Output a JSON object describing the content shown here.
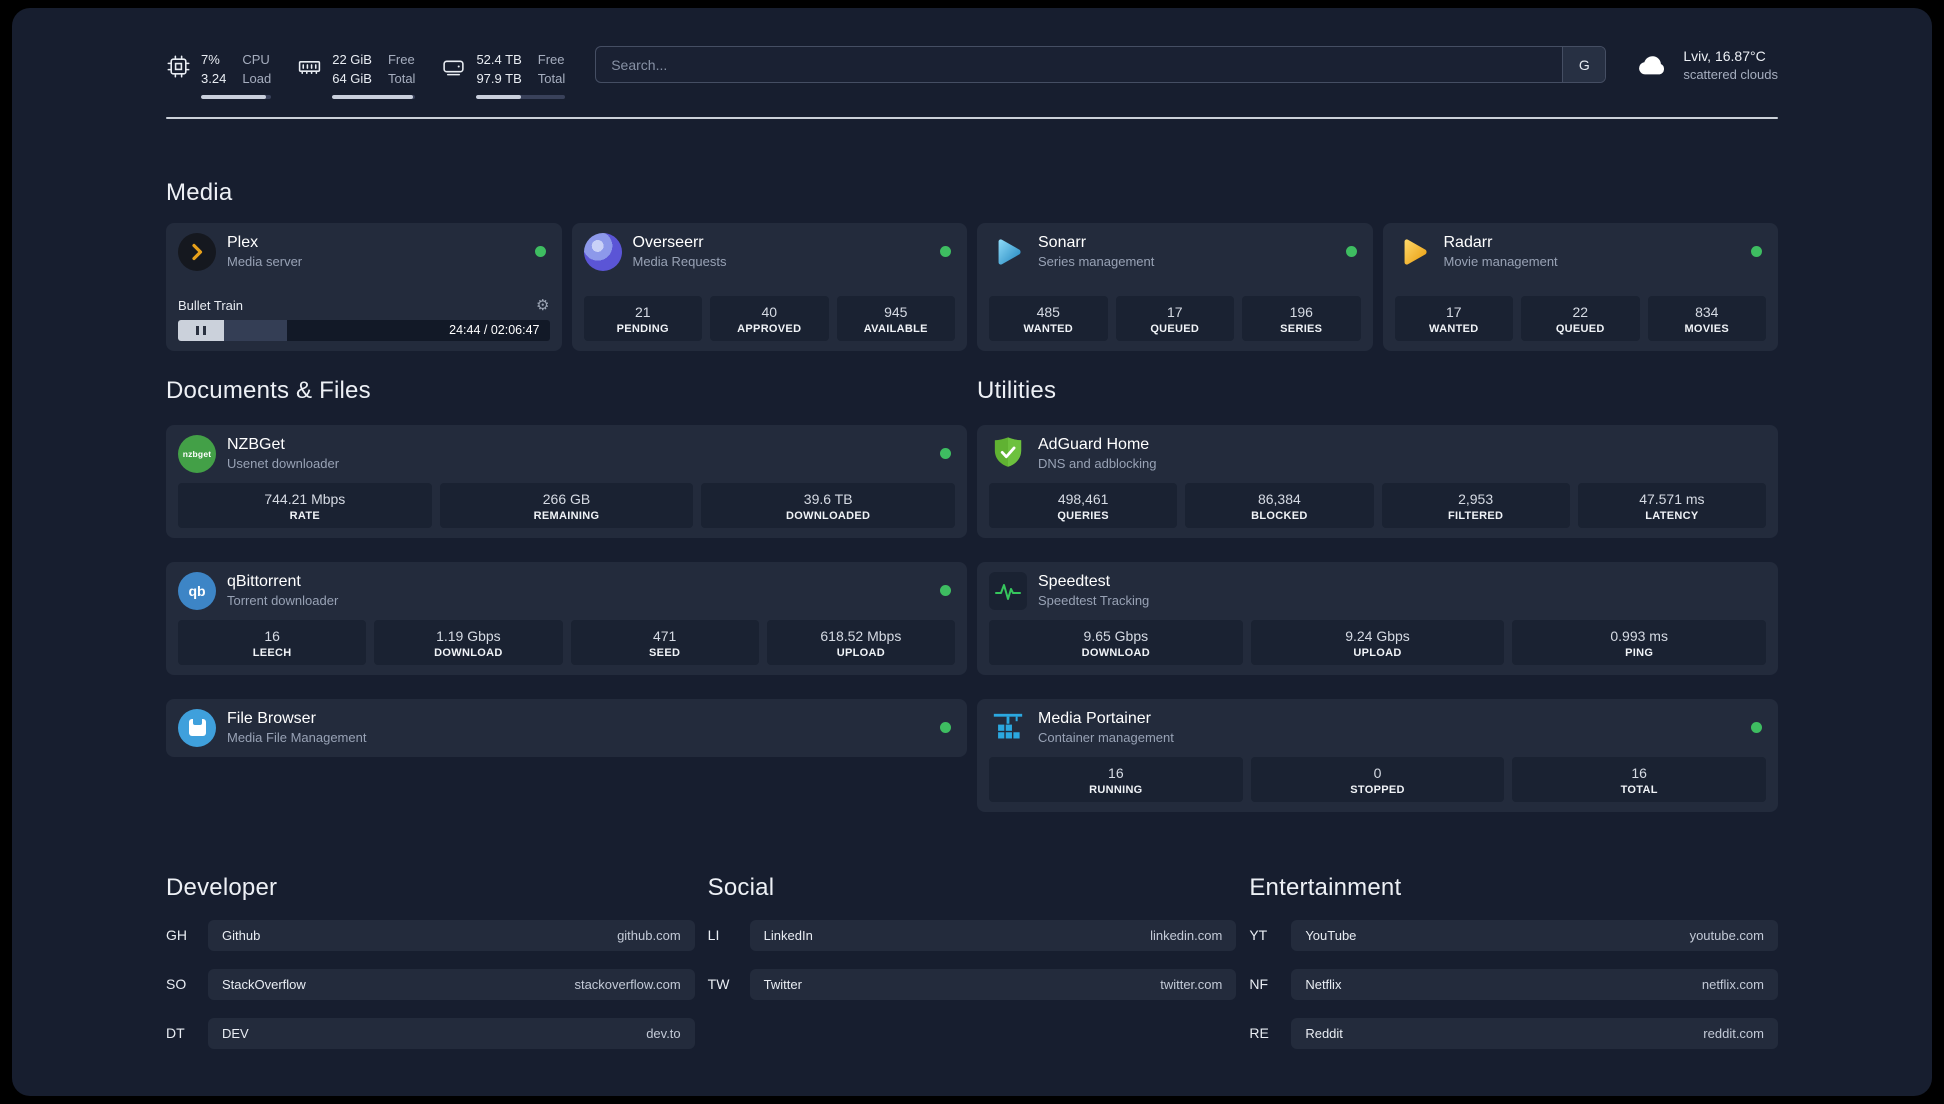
{
  "header": {
    "cpu": {
      "value_top": "7%",
      "value_bottom": "3.24",
      "label_top": "CPU",
      "label_bottom": "Load",
      "bar_percent": 93
    },
    "ram": {
      "value_top": "22 GiB",
      "value_bottom": "64 GiB",
      "label_top": "Free",
      "label_bottom": "Total",
      "bar_percent": 97
    },
    "disk": {
      "value_top": "52.4 TB",
      "value_bottom": "97.9 TB",
      "label_top": "Free",
      "label_bottom": "Total",
      "bar_percent": 50
    },
    "search": {
      "placeholder": "Search...",
      "button_label": "G"
    },
    "weather": {
      "location": "Lviv, 16.87°C",
      "condition": "scattered clouds"
    }
  },
  "sections": {
    "media": {
      "title": "Media",
      "plex": {
        "title": "Plex",
        "subtitle": "Media server",
        "now_playing": "Bullet Train",
        "time": "24:44 / 02:06:47",
        "progress_percent": 19.5
      },
      "overseerr": {
        "title": "Overseerr",
        "subtitle": "Media Requests",
        "stats": [
          {
            "value": "21",
            "label": "PENDING"
          },
          {
            "value": "40",
            "label": "APPROVED"
          },
          {
            "value": "945",
            "label": "AVAILABLE"
          }
        ]
      },
      "sonarr": {
        "title": "Sonarr",
        "subtitle": "Series management",
        "stats": [
          {
            "value": "485",
            "label": "WANTED"
          },
          {
            "value": "17",
            "label": "QUEUED"
          },
          {
            "value": "196",
            "label": "SERIES"
          }
        ]
      },
      "radarr": {
        "title": "Radarr",
        "subtitle": "Movie management",
        "stats": [
          {
            "value": "17",
            "label": "WANTED"
          },
          {
            "value": "22",
            "label": "QUEUED"
          },
          {
            "value": "834",
            "label": "MOVIES"
          }
        ]
      }
    },
    "documents": {
      "title": "Documents & Files",
      "nzbget": {
        "title": "NZBGet",
        "subtitle": "Usenet downloader",
        "icon_text": "nzbget",
        "stats": [
          {
            "value": "744.21 Mbps",
            "label": "RATE"
          },
          {
            "value": "266 GB",
            "label": "REMAINING"
          },
          {
            "value": "39.6 TB",
            "label": "DOWNLOADED"
          }
        ]
      },
      "qbittorrent": {
        "title": "qBittorrent",
        "subtitle": "Torrent downloader",
        "icon_text": "qb",
        "stats": [
          {
            "value": "16",
            "label": "LEECH"
          },
          {
            "value": "1.19 Gbps",
            "label": "DOWNLOAD"
          },
          {
            "value": "471",
            "label": "SEED"
          },
          {
            "value": "618.52 Mbps",
            "label": "UPLOAD"
          }
        ]
      },
      "filebrowser": {
        "title": "File Browser",
        "subtitle": "Media File Management"
      }
    },
    "utilities": {
      "title": "Utilities",
      "adguard": {
        "title": "AdGuard Home",
        "subtitle": "DNS and adblocking",
        "stats": [
          {
            "value": "498,461",
            "label": "QUERIES"
          },
          {
            "value": "86,384",
            "label": "BLOCKED"
          },
          {
            "value": "2,953",
            "label": "FILTERED"
          },
          {
            "value": "47.571 ms",
            "label": "LATENCY"
          }
        ]
      },
      "speedtest": {
        "title": "Speedtest",
        "subtitle": "Speedtest Tracking",
        "stats": [
          {
            "value": "9.65 Gbps",
            "label": "DOWNLOAD"
          },
          {
            "value": "9.24 Gbps",
            "label": "UPLOAD"
          },
          {
            "value": "0.993 ms",
            "label": "PING"
          }
        ]
      },
      "portainer": {
        "title": "Media Portainer",
        "subtitle": "Container management",
        "stats": [
          {
            "value": "16",
            "label": "RUNNING"
          },
          {
            "value": "0",
            "label": "STOPPED"
          },
          {
            "value": "16",
            "label": "TOTAL"
          }
        ]
      }
    },
    "bookmarks": [
      {
        "title": "Developer",
        "items": [
          {
            "abbr": "GH",
            "name": "Github",
            "url": "github.com"
          },
          {
            "abbr": "SO",
            "name": "StackOverflow",
            "url": "stackoverflow.com"
          },
          {
            "abbr": "DT",
            "name": "DEV",
            "url": "dev.to"
          }
        ]
      },
      {
        "title": "Social",
        "items": [
          {
            "abbr": "LI",
            "name": "LinkedIn",
            "url": "linkedin.com"
          },
          {
            "abbr": "TW",
            "name": "Twitter",
            "url": "twitter.com"
          }
        ]
      },
      {
        "title": "Entertainment",
        "items": [
          {
            "abbr": "YT",
            "name": "YouTube",
            "url": "youtube.com"
          },
          {
            "abbr": "NF",
            "name": "Netflix",
            "url": "netflix.com"
          },
          {
            "abbr": "RE",
            "name": "Reddit",
            "url": "reddit.com"
          }
        ]
      }
    ]
  }
}
